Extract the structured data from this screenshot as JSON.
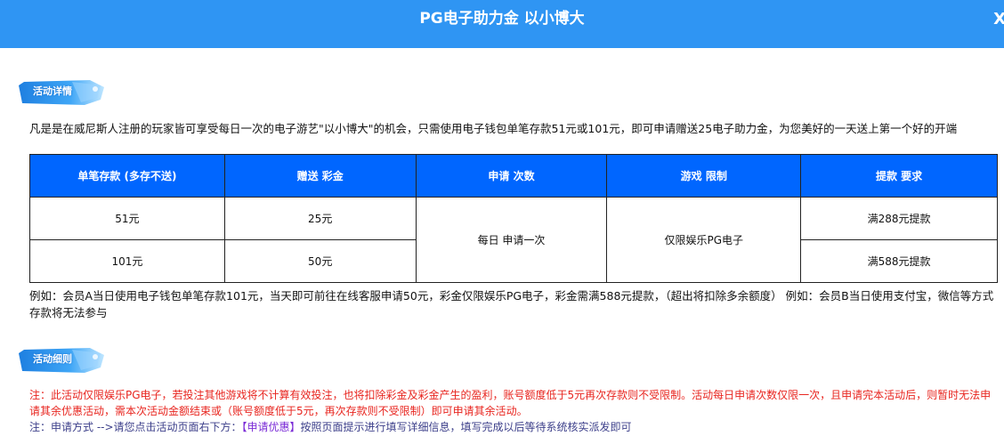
{
  "header": {
    "title": "PG电子助力金 以小博大",
    "close_glyph": "X"
  },
  "sections": {
    "details_label": "活动详情",
    "rules_label": "活动细则"
  },
  "intro_text": "凡是是在威尼斯人注册的玩家皆可享受每日一次的电子游艺\"以小博大\"的机会，只需使用电子钱包单笔存款51元或101元，即可申请赠送25电子助力金，为您美好的一天送上第一个好的开端",
  "table": {
    "headers": [
      "单笔存款 (多存不送)",
      "赠送 彩金",
      "申请 次数",
      "游戏 限制",
      "提款 要求"
    ],
    "rows": [
      {
        "deposit": "51元",
        "bonus": "25元",
        "withdraw": "满288元提款"
      },
      {
        "deposit": "101元",
        "bonus": "50元",
        "withdraw": "满588元提款"
      }
    ],
    "apply_times": "每日 申请一次",
    "game_limit": "仅限娱乐PG电子"
  },
  "example_text": "例如：会员A当日使用电子钱包单笔存款101元，当天即可前往在线客服申请50元，彩金仅限娱乐PG电子，彩金需满588元提款，（超出将扣除多余额度） 例如：会员B当日使用支付宝，微信等方式存款将无法参与",
  "notes": {
    "red": "注：此活动仅限娱乐PG电子，若投注其他游戏将不计算有效投注，也将扣除彩金及彩金产生的盈利，账号额度低于5元再次存款则不受限制。活动每日申请次数仅限一次，且申请完本活动后，则暂时无法申请其余优惠活动，需本次活动金额结束或（账号额度低于5元，再次存款则不受限制）即可申请其余活动。",
    "blue_prefix": "注：申请方式 -->请您点击活动页面右下方：",
    "blue_bracket": "【申请优惠】",
    "blue_suffix": "按照页面提示进行填写详细信息，填写完成以后等待系统核实派发即可"
  },
  "colors": {
    "header_bg": "#2f95f3",
    "table_header_bg": "#0066ff",
    "note_red": "#e8251f",
    "note_blue": "#3c3f8a"
  },
  "icons": [
    "section-tag-badge-icon",
    "close-icon"
  ]
}
